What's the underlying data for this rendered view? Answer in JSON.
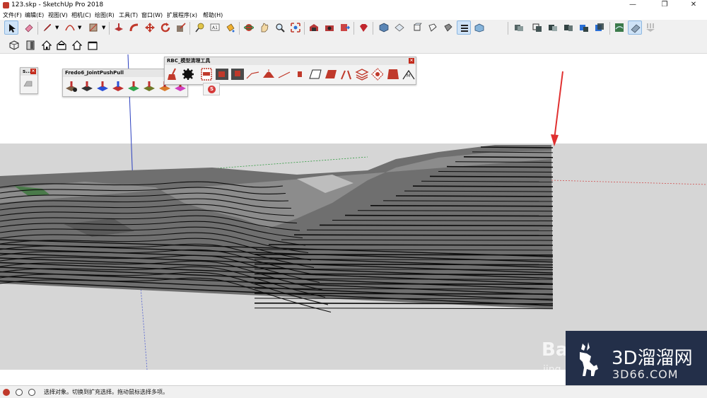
{
  "window": {
    "title": "123.skp - SketchUp Pro 2018",
    "minimize_glyph": "—",
    "maximize_glyph": "❐",
    "close_glyph": "✕"
  },
  "menu": {
    "items": [
      "文件(F)",
      "编辑(E)",
      "视图(V)",
      "相机(C)",
      "绘图(R)",
      "工具(T)",
      "窗口(W)",
      "扩展程序(x)",
      "帮助(H)"
    ]
  },
  "toolbar1": {
    "icons": [
      "select-icon",
      "eraser-icon",
      "pencil-icon",
      "arc-icon",
      "rectangle-icon",
      "pushpull-icon",
      "followme-icon",
      "move-icon",
      "rotate-icon",
      "scale-icon",
      "tape-icon",
      "text-icon",
      "paint-icon",
      "orbit-icon",
      "pan-icon",
      "zoom-icon",
      "zoom-extents-icon",
      "warehouse-icon",
      "extension-warehouse-icon",
      "send-layout-icon",
      "ruby-icon",
      "iso-view-icon",
      "top-view-icon",
      "front-view-icon",
      "right-view-icon",
      "back-view-icon",
      "left-view-icon",
      "xray-icon",
      "wireframe-icon",
      "solid-union-icon",
      "solid-intersect-icon",
      "solid-trim-icon",
      "solid-split-icon",
      "solid-subtract-icon",
      "solid-shell-icon",
      "sandbox-contour-icon",
      "sandbox-mesh-icon",
      "sandbox-drape-icon"
    ]
  },
  "toolbar2": {
    "icons": [
      "views-iso-icon",
      "views-door-icon",
      "house-icon",
      "house-front-icon",
      "house-outline-icon",
      "house-back-icon"
    ]
  },
  "palettes": {
    "small": {
      "title": "s...",
      "close": "×"
    },
    "joint": {
      "title": "Fredo6_JointPushPull",
      "close": "×"
    },
    "rbc": {
      "title": "RBC_模型清理工具",
      "close": "×"
    },
    "s_badge": "S"
  },
  "status": {
    "text": "选择对象。切换到扩充选择。拖动鼠标选择多项。"
  },
  "watermark": {
    "brand": "3D溜溜网",
    "domain": "3D66.COM",
    "baidu": "Bai",
    "baidu_sub": "jing"
  },
  "colors": {
    "sky": "#ffffff",
    "ground": "#d6d6d6",
    "terrain": "#7b7b7b",
    "edge": "#111111",
    "arrow": "#e03030",
    "accent": "#2a6fd6"
  }
}
